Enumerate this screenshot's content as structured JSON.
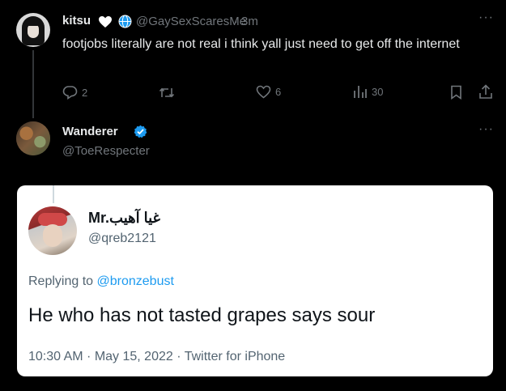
{
  "tweet1": {
    "name": "kitsu",
    "handle": "@GaySexScaresMe",
    "sep": "·",
    "time": "3m",
    "text": "footjobs literally are not real i think yall just need to get off the internet",
    "replies": "2",
    "likes": "6",
    "views": "30"
  },
  "tweet2": {
    "name": "Wanderer",
    "handle": "@ToeRespecter"
  },
  "quoted_image": {
    "name": "Mr.غيا آهيب",
    "handle": "@qreb2121",
    "replying_prefix": "Replying to ",
    "replying_to": "@bronzebust",
    "text": "He who has not tasted grapes says sour",
    "meta": "10:30 AM · May 15, 2022 · Twitter for iPhone"
  },
  "icons": {
    "more": "more-icon",
    "reply": "reply-icon",
    "retweet": "retweet-icon",
    "like": "heart-icon",
    "views": "views-icon",
    "bookmark": "bookmark-icon",
    "share": "share-icon"
  },
  "colors": {
    "background": "#000000",
    "text_primary": "#e7e9ea",
    "text_secondary": "#71767b",
    "accent": "#1d9bf0"
  }
}
